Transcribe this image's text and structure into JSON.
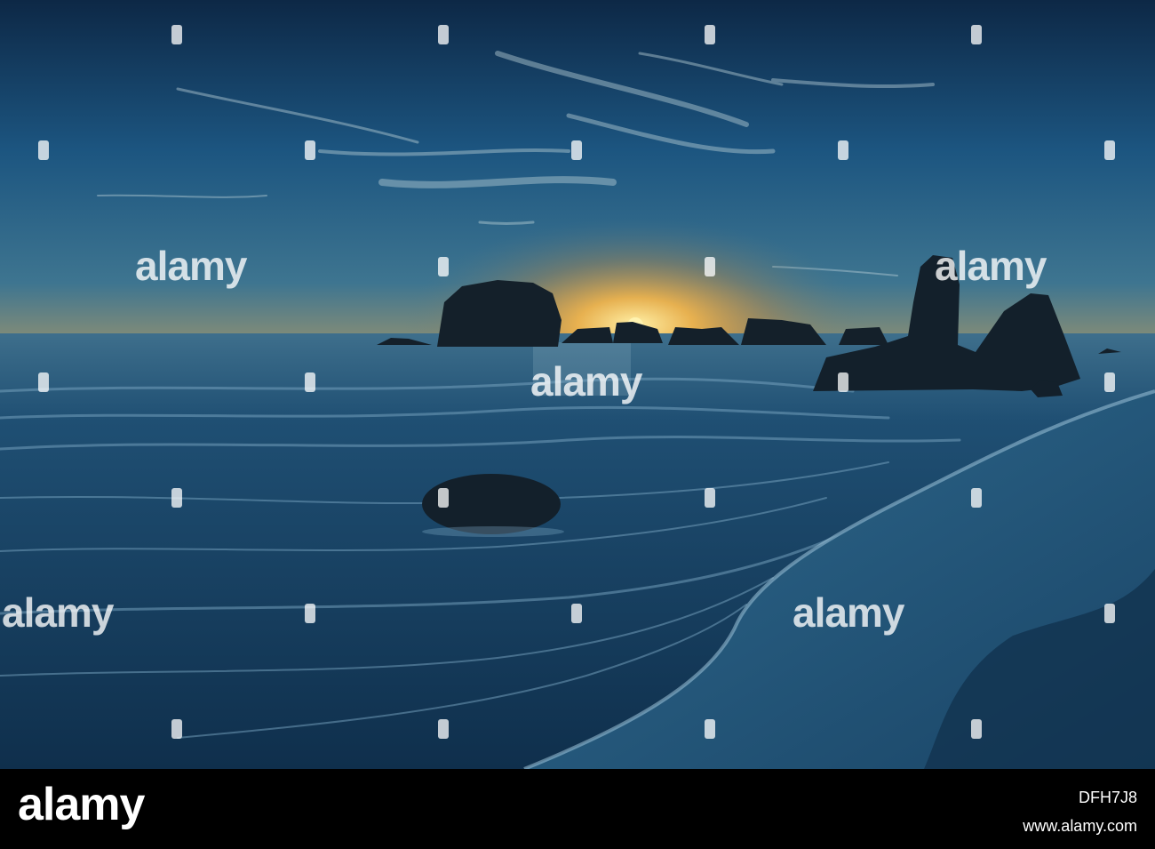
{
  "watermark": {
    "brand": "alamy"
  },
  "footer": {
    "logo": "alamy",
    "image_code": "DFH7J8",
    "site": "www.alamy.com"
  },
  "colors": {
    "sky_top": "#0f2a4a",
    "sky_mid": "#1f5a82",
    "horizon_glow": "#f2a33a",
    "sun": "#ffe58a",
    "sea": "#163e5e",
    "wet_sand": "#1d4f75",
    "rock": "#14202a"
  }
}
